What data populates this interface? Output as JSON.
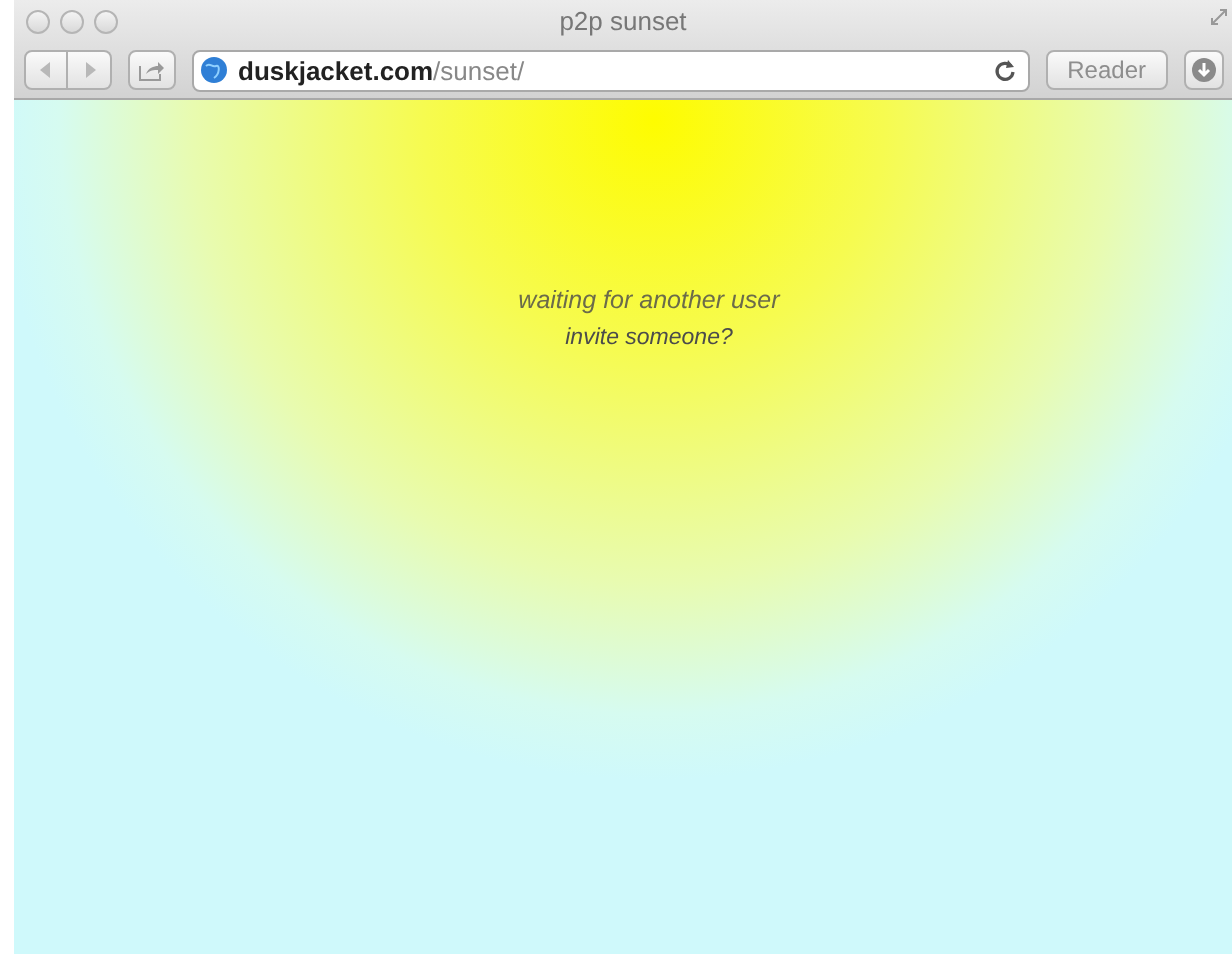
{
  "window": {
    "title": "p2p sunset"
  },
  "toolbar": {
    "url_domain": "duskjacket.com",
    "url_path": "/sunset/",
    "reader": {
      "label": "Reader",
      "disabled": true
    }
  },
  "content": {
    "status": "waiting for another user",
    "link": "invite someone?"
  }
}
